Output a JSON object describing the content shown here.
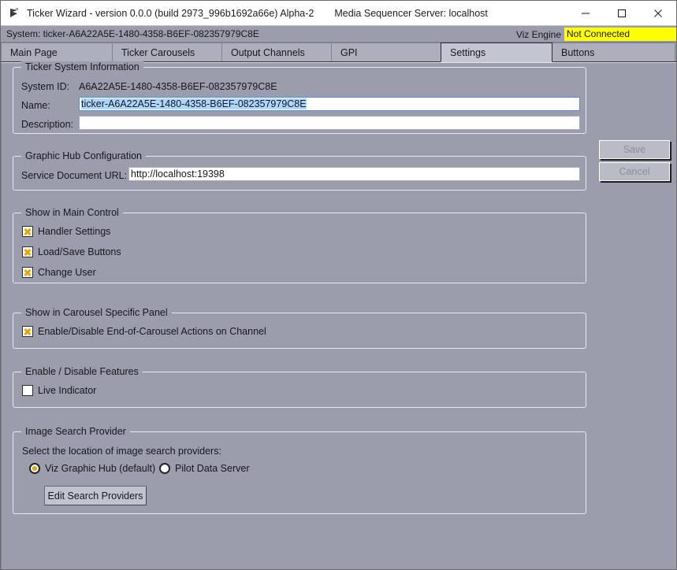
{
  "window": {
    "icon": "flag-app-icon",
    "title": "Ticker Wizard - version 0.0.0 (build 2973_996b1692a66e) Alpha-2",
    "subtitle": "Media Sequencer Server: localhost",
    "minimize_label": "minimize-icon",
    "maximize_label": "maximize-icon",
    "close_label": "close-icon"
  },
  "status": {
    "system_text": "System: ticker-A6A22A5E-1480-4358-B6EF-082357979C8E",
    "viz_engine_label": "Viz Engine",
    "viz_engine_state": "Not Connected",
    "viz_engine_state_color": "#ffff00"
  },
  "tabs": [
    {
      "label": "Main Page",
      "selected": false
    },
    {
      "label": "Ticker Carousels",
      "selected": false
    },
    {
      "label": "Output Channels",
      "selected": false
    },
    {
      "label": "GPI",
      "selected": false
    },
    {
      "label": "Settings",
      "selected": true
    },
    {
      "label": "Buttons",
      "selected": false
    }
  ],
  "actions": {
    "save_label": "Save",
    "save_enabled": false,
    "cancel_label": "Cancel",
    "cancel_enabled": false
  },
  "ticker_system_information": {
    "legend": "Ticker System Information",
    "system_id_label": "System ID:",
    "system_id_value": "A6A22A5E-1480-4358-B6EF-082357979C8E",
    "name_label": "Name:",
    "name_value": "ticker-A6A22A5E-1480-4358-B6EF-082357979C8E",
    "description_label": "Description:",
    "description_value": ""
  },
  "graphic_hub_configuration": {
    "legend": "Graphic Hub Configuration",
    "service_document_url_label": "Service Document URL:",
    "service_document_url_value": "http://localhost:19398"
  },
  "show_in_main_control": {
    "legend": "Show in Main Control",
    "items": [
      {
        "label": "Handler Settings",
        "checked": true
      },
      {
        "label": "Load/Save Buttons",
        "checked": true
      },
      {
        "label": "Change User",
        "checked": true
      }
    ]
  },
  "show_in_carousel_specific_panel": {
    "legend": "Show in Carousel Specific Panel",
    "items": [
      {
        "label": "Enable/Disable End-of-Carousel Actions on Channel",
        "checked": true
      }
    ]
  },
  "enable_disable_features": {
    "legend": "Enable / Disable Features",
    "items": [
      {
        "label": "Live Indicator",
        "checked": false
      }
    ]
  },
  "image_search_provider": {
    "legend": "Image Search Provider",
    "description": "Select the location of image search providers:",
    "options": [
      {
        "label": "Viz Graphic Hub (default)",
        "selected": true
      },
      {
        "label": "Pilot Data Server",
        "selected": false
      }
    ],
    "edit_button_label": "Edit Search Providers"
  },
  "colors": {
    "window_bg": "#9b9dac",
    "accent_check": "#e8a400",
    "focus_border": "#4d90d6",
    "selection_bg": "#add6ff"
  }
}
